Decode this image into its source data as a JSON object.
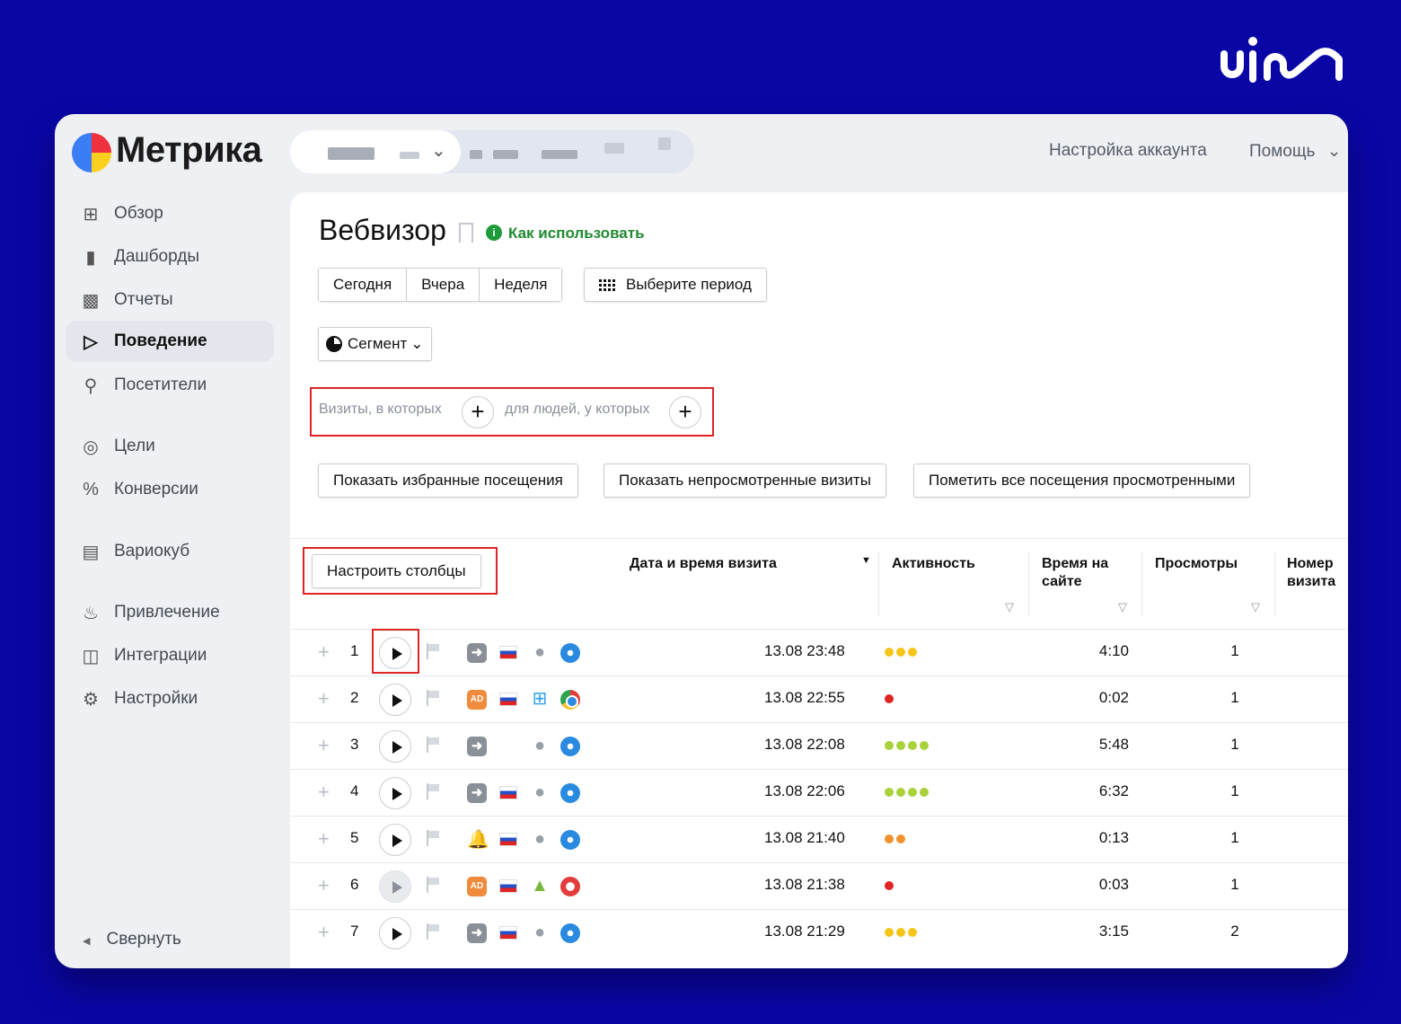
{
  "app": {
    "name": "Метрика"
  },
  "topbar": {
    "account_settings": "Настройка аккаунта",
    "help": "Помощь"
  },
  "sidebar": {
    "items": [
      {
        "label": "Обзор",
        "icon": "grid-icon"
      },
      {
        "label": "Дашборды",
        "icon": "dashboard-icon"
      },
      {
        "label": "Отчеты",
        "icon": "reports-icon"
      },
      {
        "label": "Поведение",
        "icon": "play-outline-icon",
        "active": true
      },
      {
        "label": "Посетители",
        "icon": "user-icon"
      },
      {
        "label": "Цели",
        "icon": "target-icon"
      },
      {
        "label": "Конверсии",
        "icon": "percent-icon"
      },
      {
        "label": "Вариокуб",
        "icon": "cube-icon"
      },
      {
        "label": "Привлечение",
        "icon": "fire-icon"
      },
      {
        "label": "Интеграции",
        "icon": "puzzle-icon"
      },
      {
        "label": "Настройки",
        "icon": "gear-icon"
      }
    ],
    "collapse": "Свернуть"
  },
  "page": {
    "title": "Вебвизор",
    "how_to": "Как использовать",
    "periods": [
      "Сегодня",
      "Вчера",
      "Неделя"
    ],
    "choose_period": "Выберите период",
    "segment": "Сегмент",
    "filter_visits": "Визиты, в которых",
    "filter_people": "для людей, у которых",
    "show_favorites": "Показать избранные посещения",
    "show_unviewed": "Показать непросмотренные визиты",
    "mark_all_viewed": "Пометить все посещения просмотренными",
    "configure_columns": "Настроить столбцы"
  },
  "table": {
    "columns": {
      "datetime": "Дата и время визита",
      "activity": "Активность",
      "time_on_site_1": "Время на",
      "time_on_site_2": "сайте",
      "views": "Просмотры",
      "visit_number_1": "Номер",
      "visit_number_2": "визита"
    },
    "rows": [
      {
        "n": "1",
        "source": "direct",
        "country": "ru",
        "os": "apple",
        "browser": "safari",
        "date": "13.08 23:48",
        "activity": [
          "#f5c518",
          "#f5c518",
          "#f5c518"
        ],
        "time": "4:10",
        "views": "1",
        "play": "normal"
      },
      {
        "n": "2",
        "source": "ad",
        "country": "ru",
        "os": "windows",
        "browser": "chrome",
        "date": "13.08 22:55",
        "activity": [
          "#e02424"
        ],
        "time": "0:02",
        "views": "1",
        "play": "normal"
      },
      {
        "n": "3",
        "source": "direct",
        "country": "",
        "os": "apple",
        "browser": "safari",
        "date": "13.08 22:08",
        "activity": [
          "#a8d13a",
          "#a8d13a",
          "#a8d13a",
          "#a8d13a"
        ],
        "time": "5:48",
        "views": "1",
        "play": "normal"
      },
      {
        "n": "4",
        "source": "direct",
        "country": "ru",
        "os": "apple",
        "browser": "safari",
        "date": "13.08 22:06",
        "activity": [
          "#a8d13a",
          "#a8d13a",
          "#a8d13a",
          "#a8d13a"
        ],
        "time": "6:32",
        "views": "1",
        "play": "normal"
      },
      {
        "n": "5",
        "source": "notification",
        "country": "ru",
        "os": "apple",
        "browser": "safari",
        "date": "13.08 21:40",
        "activity": [
          "#f0922e",
          "#f0922e"
        ],
        "time": "0:13",
        "views": "1",
        "play": "normal"
      },
      {
        "n": "6",
        "source": "ad",
        "country": "ru",
        "os": "android",
        "browser": "opera",
        "date": "13.08 21:38",
        "activity": [
          "#e02424"
        ],
        "time": "0:03",
        "views": "1",
        "play": "grey"
      },
      {
        "n": "7",
        "source": "direct",
        "country": "ru",
        "os": "apple",
        "browser": "safari",
        "date": "13.08 21:29",
        "activity": [
          "#f5c518",
          "#f5c518",
          "#f5c518"
        ],
        "time": "3:15",
        "views": "2",
        "play": "normal"
      }
    ]
  },
  "colors": {
    "background": "#0a06a6",
    "highlight_box": "#e02424",
    "link_green": "#1e8a30"
  }
}
